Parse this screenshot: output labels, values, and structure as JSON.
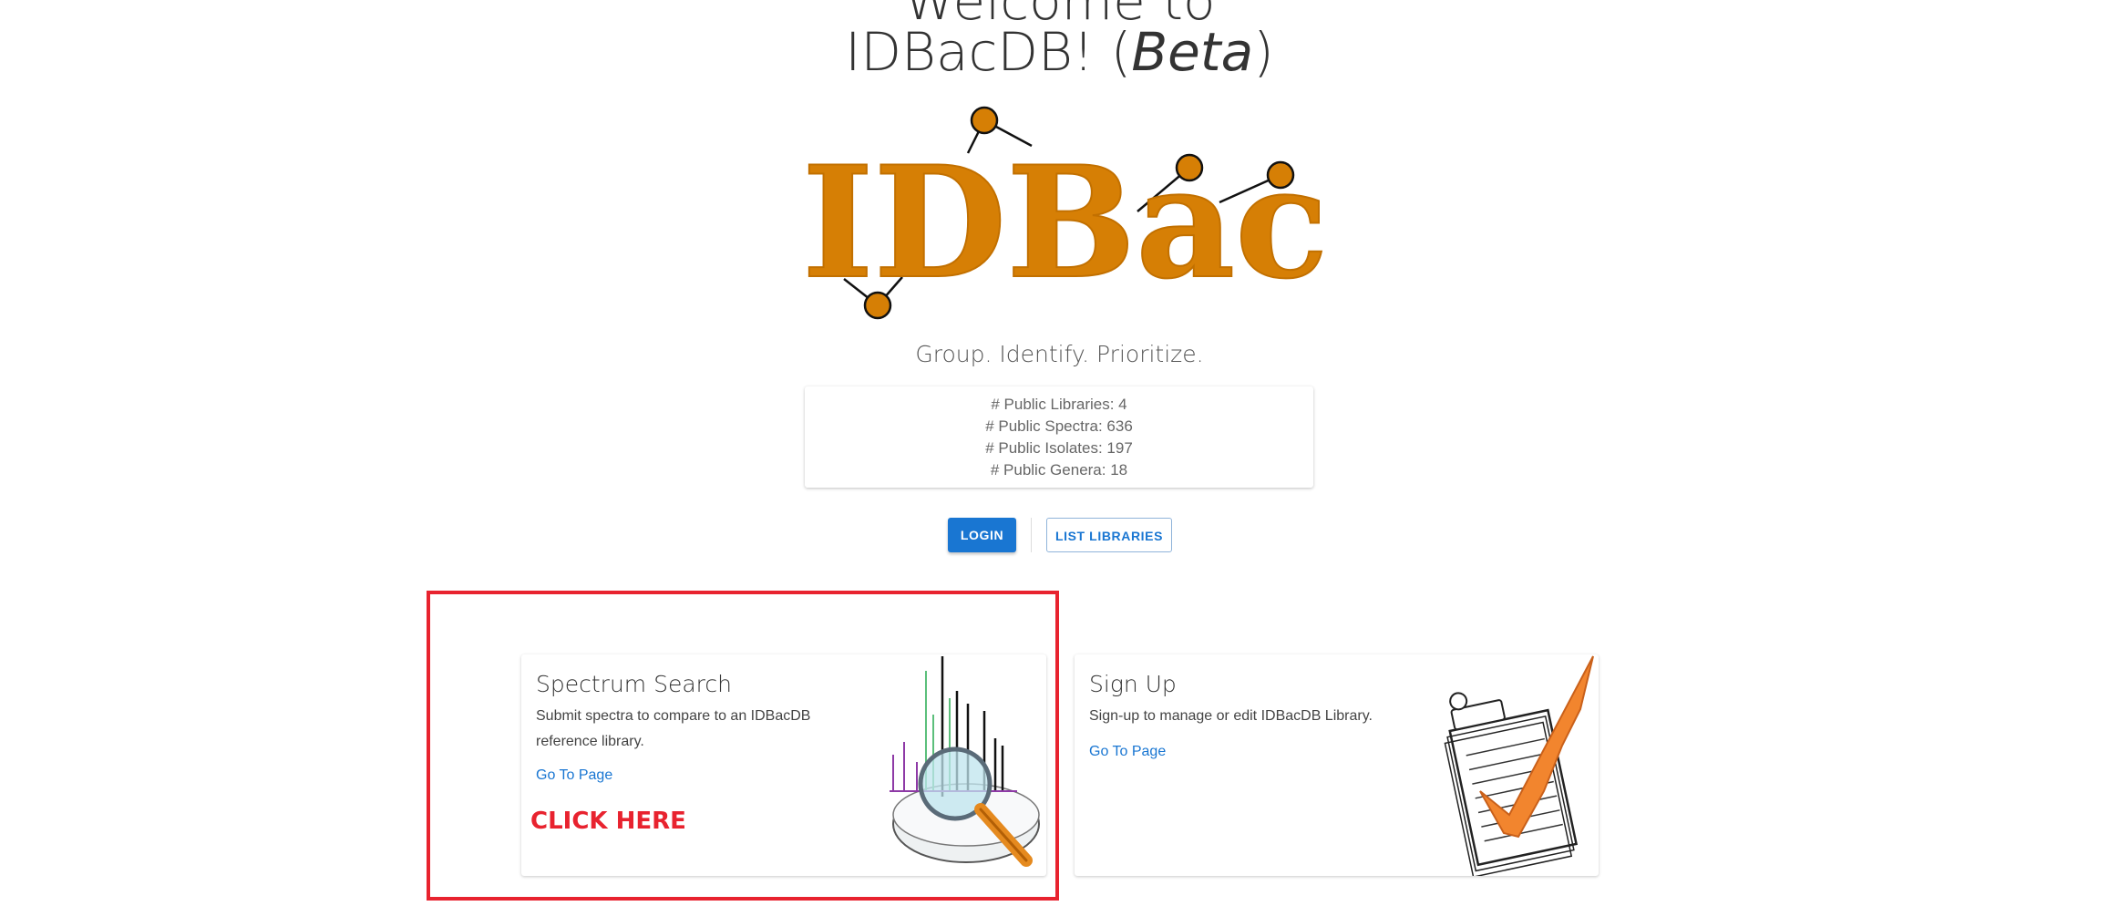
{
  "header": {
    "welcome_line1": "Welcome to",
    "welcome_line2_prefix": "IDBacDB! (",
    "welcome_line2_italic": "Beta",
    "welcome_line2_suffix": ")"
  },
  "logo": {
    "text": "IDBac",
    "color": "#d67f05"
  },
  "tagline": "Group. Identify. Prioritize.",
  "stats": [
    "# Public Libraries: 4",
    "# Public Spectra: 636",
    "# Public Isolates: 197",
    "# Public Genera: 18"
  ],
  "buttons": {
    "login": "LOGIN",
    "list_libraries": "LIST LIBRARIES"
  },
  "cards": [
    {
      "title": "Spectrum Search",
      "description": "Submit spectra to compare to an IDBacDB reference library.",
      "link": "Go To Page",
      "icon": "magnifier-spectrum-icon"
    },
    {
      "title": "Sign Up",
      "description": "Sign-up to manage or edit IDBacDB Library.",
      "link": "Go To Page",
      "icon": "signup-clipboard-check-icon"
    }
  ],
  "annotation": {
    "text": "CLICK HERE",
    "color": "#e8232f"
  }
}
